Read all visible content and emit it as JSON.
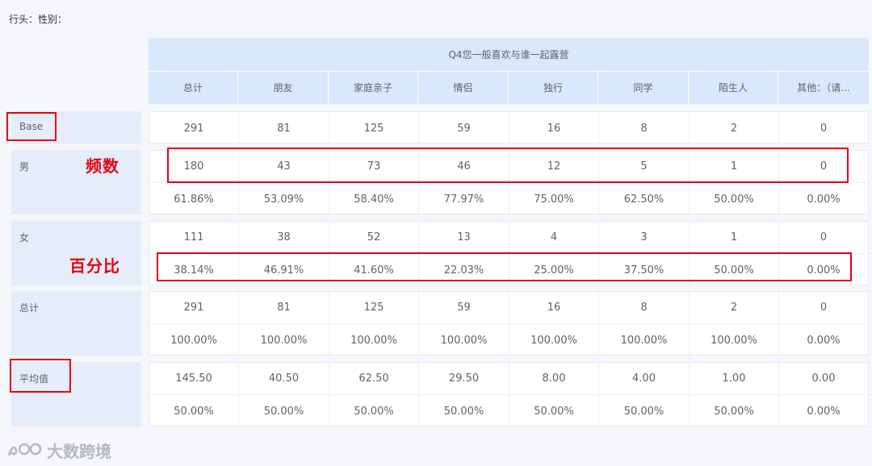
{
  "row_header_label": "行头：性别：",
  "question_title": "Q4您一般喜欢与谁一起露营",
  "columns": [
    "总计",
    "朋友",
    "家庭亲子",
    "情侣",
    "独行",
    "同学",
    "陌生人",
    "其他：（请..."
  ],
  "base": {
    "label": "Base",
    "values": [
      "291",
      "81",
      "125",
      "59",
      "16",
      "8",
      "2",
      "0"
    ]
  },
  "male": {
    "label": "男",
    "counts": [
      "180",
      "43",
      "73",
      "46",
      "12",
      "5",
      "1",
      "0"
    ],
    "percents": [
      "61.86%",
      "53.09%",
      "58.40%",
      "77.97%",
      "75.00%",
      "62.50%",
      "50.00%",
      "0.00%"
    ]
  },
  "female": {
    "label": "女",
    "counts": [
      "111",
      "38",
      "52",
      "13",
      "4",
      "3",
      "1",
      "0"
    ],
    "percents": [
      "38.14%",
      "46.91%",
      "41.60%",
      "22.03%",
      "25.00%",
      "37.50%",
      "50.00%",
      "0.00%"
    ]
  },
  "total": {
    "label": "总计",
    "counts": [
      "291",
      "81",
      "125",
      "59",
      "16",
      "8",
      "2",
      "0"
    ],
    "percents": [
      "100.00%",
      "100.00%",
      "100.00%",
      "100.00%",
      "100.00%",
      "100.00%",
      "100.00%",
      "0.00%"
    ]
  },
  "mean": {
    "label": "平均值",
    "values": [
      "145.50",
      "40.50",
      "62.50",
      "29.50",
      "8.00",
      "4.00",
      "1.00",
      "0.00"
    ],
    "percents": [
      "50.00%",
      "50.00%",
      "50.00%",
      "50.00%",
      "50.00%",
      "50.00%",
      "50.00%",
      "0.00%"
    ]
  },
  "annotations": {
    "frequency_label": "频数",
    "percentage_label": "百分比",
    "highlight_color": "#e60012"
  },
  "watermark": {
    "text": "大数跨境"
  }
}
